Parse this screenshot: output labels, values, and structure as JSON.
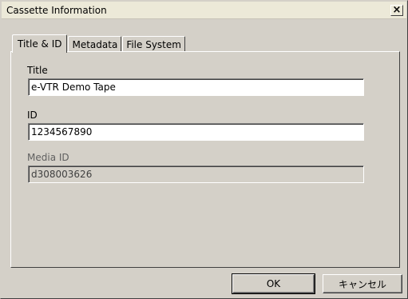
{
  "window": {
    "title": "Cassette Information",
    "close_label": "×"
  },
  "tabs": [
    {
      "label": "Title & ID",
      "active": true
    },
    {
      "label": "Metadata",
      "active": false
    },
    {
      "label": "File System",
      "active": false
    }
  ],
  "fields": {
    "title": {
      "label": "Title",
      "value": "e-VTR Demo Tape"
    },
    "id": {
      "label": "ID",
      "value": "1234567890"
    },
    "media_id": {
      "label": "Media ID",
      "value": "d308003626",
      "disabled": true
    }
  },
  "buttons": {
    "ok": "OK",
    "cancel": "キャンセル"
  }
}
